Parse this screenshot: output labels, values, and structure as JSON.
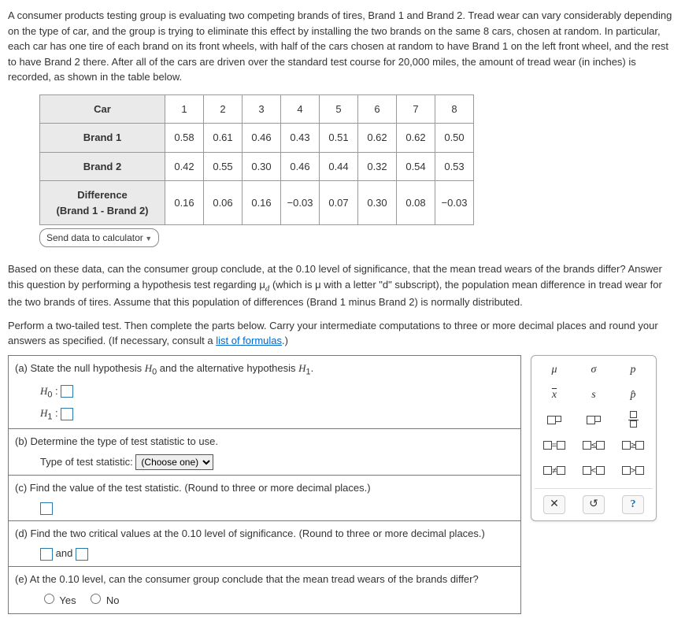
{
  "intro": "A consumer products testing group is evaluating two competing brands of tires, Brand 1 and Brand 2. Tread wear can vary considerably depending on the type of car, and the group is trying to eliminate this effect by installing the two brands on the same 8 cars, chosen at random. In particular, each car has one tire of each brand on its front wheels, with half of the cars chosen at random to have Brand 1 on the left front wheel, and the rest to have Brand 2 there. After all of the cars are driven over the standard test course for 20,000 miles, the amount of tread wear (in inches) is recorded, as shown in the table below.",
  "table": {
    "headers": {
      "car": "Car",
      "c1": "1",
      "c2": "2",
      "c3": "3",
      "c4": "4",
      "c5": "5",
      "c6": "6",
      "c7": "7",
      "c8": "8"
    },
    "rows": {
      "b1": {
        "label": "Brand 1",
        "v": [
          "0.58",
          "0.61",
          "0.46",
          "0.43",
          "0.51",
          "0.62",
          "0.62",
          "0.50"
        ]
      },
      "b2": {
        "label": "Brand 2",
        "v": [
          "0.42",
          "0.55",
          "0.30",
          "0.46",
          "0.44",
          "0.32",
          "0.54",
          "0.53"
        ]
      },
      "diff": {
        "label_l1": "Difference",
        "label_l2": "(Brand 1 - Brand 2)",
        "v": [
          "0.16",
          "0.06",
          "0.16",
          "−0.03",
          "0.07",
          "0.30",
          "0.08",
          "−0.03"
        ]
      }
    }
  },
  "send_data": "Send data to calculator",
  "question_text": "Based on these data, can the consumer group conclude, at the 0.10 level of significance, that the mean tread wears of the brands differ? Answer this question by performing a hypothesis test regarding μ",
  "question_sub": "d",
  "question_text2": " (which is μ with a letter \"d\" subscript), the population mean difference in tread wear for the two brands of tires. Assume that this population of differences (Brand 1 minus Brand 2) is normally distributed.",
  "instructions_pre": "Perform a two-tailed test. Then complete the parts below. Carry your intermediate computations to three or more decimal places and round your answers as specified. (If necessary, consult a ",
  "link_text": "list of formulas",
  "instructions_post": ".)",
  "parts": {
    "a": {
      "prompt": "(a)  State the null hypothesis ",
      "h0": "H",
      "sub0": "0",
      "and": " and the alternative hypothesis ",
      "h1": "H",
      "sub1": "1",
      "end": ".",
      "line1": "H",
      "line1_sub": "0",
      "colon": " : ",
      "line2": "H",
      "line2_sub": "1"
    },
    "b": {
      "prompt": "(b)  Determine the type of test statistic to use.",
      "label": "Type of test statistic:",
      "choose": "(Choose one)"
    },
    "c": {
      "prompt": "(c)  Find the value of the test statistic. (Round to three or more decimal places.)"
    },
    "d": {
      "prompt": "(d)  Find the two critical values at the 0.10 level of significance. (Round to three or more decimal places.)",
      "and": " and "
    },
    "e": {
      "prompt": "(e)  At the 0.10 level, can the consumer group conclude that the mean tread wears of the brands differ?",
      "yes": "Yes",
      "no": "No"
    }
  },
  "palette": {
    "mu": "μ",
    "sigma": "σ",
    "p": "p",
    "xbar": "x",
    "s": "s",
    "phat": "p̂",
    "eq": "=",
    "le": "≤",
    "ge": "≥",
    "ne": "≠",
    "lt": "<",
    "gt": ">",
    "close": "✕",
    "reset": "↺",
    "help": "?"
  },
  "chart_data": {
    "type": "table",
    "title": "Tread wear (inches) for 8 cars",
    "columns": [
      "Car",
      "Brand 1",
      "Brand 2",
      "Difference (Brand 1 - Brand 2)"
    ],
    "rows": [
      [
        1,
        0.58,
        0.42,
        0.16
      ],
      [
        2,
        0.61,
        0.55,
        0.06
      ],
      [
        3,
        0.46,
        0.3,
        0.16
      ],
      [
        4,
        0.43,
        0.46,
        -0.03
      ],
      [
        5,
        0.51,
        0.44,
        0.07
      ],
      [
        6,
        0.62,
        0.32,
        0.3
      ],
      [
        7,
        0.62,
        0.54,
        0.08
      ],
      [
        8,
        0.5,
        0.53,
        -0.03
      ]
    ]
  }
}
